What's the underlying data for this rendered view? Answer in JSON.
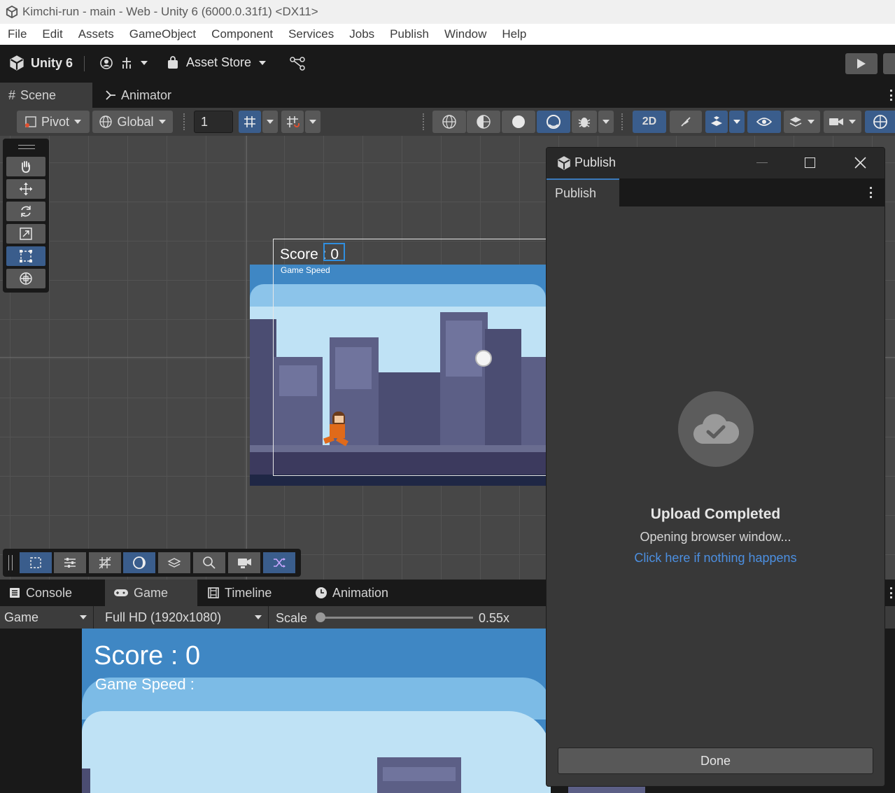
{
  "window_title": "Kimchi-run - main - Web - Unity 6 (6000.0.31f1) <DX11>",
  "menu": [
    "File",
    "Edit",
    "Assets",
    "GameObject",
    "Component",
    "Services",
    "Jobs",
    "Publish",
    "Window",
    "Help"
  ],
  "toolbar": {
    "brand": "Unity 6",
    "asset_store": "Asset Store"
  },
  "top_tabs": {
    "scene": "Scene",
    "animator": "Animator"
  },
  "scene_toolbar": {
    "pivot": "Pivot",
    "global": "Global",
    "grid_value": "1",
    "mode_2d": "2D"
  },
  "scene_overlay": {
    "score": "Score : 0",
    "game_speed": "Game Speed"
  },
  "bottom_tabs": {
    "console": "Console",
    "game": "Game",
    "timeline": "Timeline",
    "animation": "Animation"
  },
  "game_toolbar": {
    "display": "Game",
    "resolution": "Full HD (1920x1080)",
    "scale_label": "Scale",
    "scale_value": "0.55x",
    "scale_fraction": 0
  },
  "game_view": {
    "score": "Score : 0",
    "game_speed": "Game Speed :"
  },
  "publish": {
    "title": "Publish",
    "tab": "Publish",
    "status_title": "Upload Completed",
    "status_sub": "Opening browser window...",
    "link": "Click here if nothing happens",
    "done": "Done"
  },
  "colors": {
    "accent_blue": "#3a79bb",
    "link_blue": "#4c8fe0",
    "selected_tool": "#3a5d8c",
    "sky": "#4a8fc9",
    "building": "#5c5f86"
  }
}
